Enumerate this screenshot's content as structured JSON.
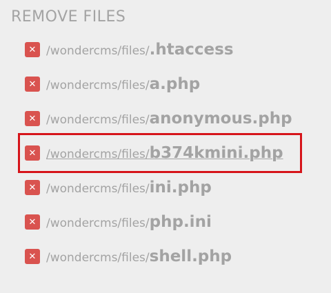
{
  "section": {
    "title": "REMOVE FILES"
  },
  "icons": {
    "remove": "close-icon"
  },
  "colors": {
    "background": "#eeeeee",
    "text": "#a3a3a3",
    "remove_button": "#d9534f",
    "selection_border": "#d6141a"
  },
  "files": [
    {
      "path": "/wondercms/files/",
      "name": ".htaccess"
    },
    {
      "path": "/wondercms/files/",
      "name": "a.php"
    },
    {
      "path": "/wondercms/files/",
      "name": "anonymous.php"
    },
    {
      "path": "/wondercms/files/",
      "name": "b374kmini.php",
      "selected": true
    },
    {
      "path": "/wondercms/files/",
      "name": "ini.php"
    },
    {
      "path": "/wondercms/files/",
      "name": "php.ini"
    },
    {
      "path": "/wondercms/files/",
      "name": "shell.php"
    }
  ],
  "remove_glyph": "✕"
}
